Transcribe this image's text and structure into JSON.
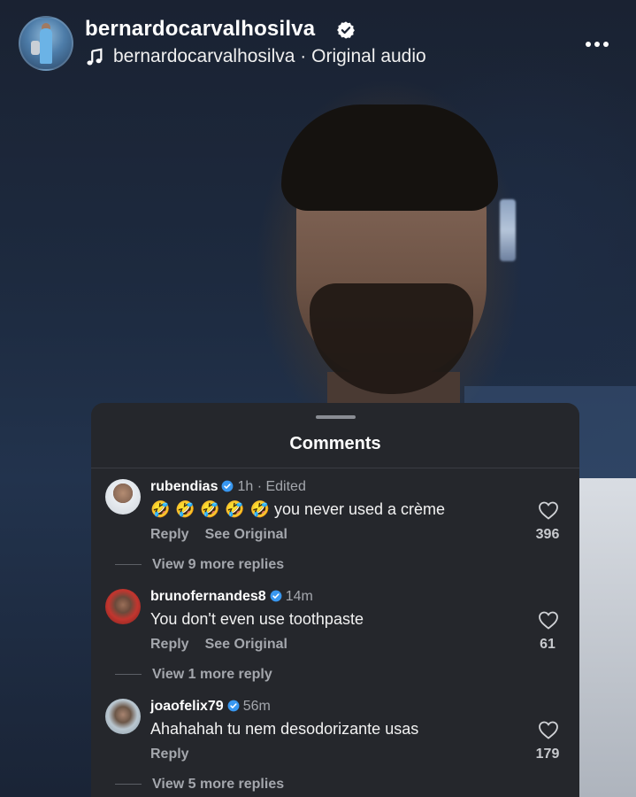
{
  "header": {
    "username": "bernardocarvalhosilva",
    "audio_owner": "bernardocarvalhosilva",
    "audio_separator": " · ",
    "audio_label": "Original audio"
  },
  "sheet": {
    "title": "Comments"
  },
  "comments": [
    {
      "user": "rubendias",
      "time": "1h · Edited",
      "emojis": "🤣 🤣 🤣 🤣 🤣",
      "text": " you never used a crème",
      "reply_label": "Reply",
      "see_original_label": "See Original",
      "likes": "396",
      "more_replies": "View 9 more replies"
    },
    {
      "user": "brunofernandes8",
      "time": "14m",
      "text": "You don't even use toothpaste",
      "reply_label": "Reply",
      "see_original_label": "See Original",
      "likes": "61",
      "more_replies": "View 1 more reply"
    },
    {
      "user": "joaofelix79",
      "time": "56m",
      "text": "Ahahahah tu nem desodorizante usas",
      "reply_label": "Reply",
      "likes": "179",
      "more_replies": "View 5 more replies"
    }
  ],
  "colors": {
    "sheet_bg": "#25272c",
    "verified_blue": "#3897f0",
    "muted_text": "#a4a7ad"
  },
  "icons": [
    "verified-badge-icon",
    "music-note-icon",
    "more-options-icon",
    "heart-icon"
  ]
}
